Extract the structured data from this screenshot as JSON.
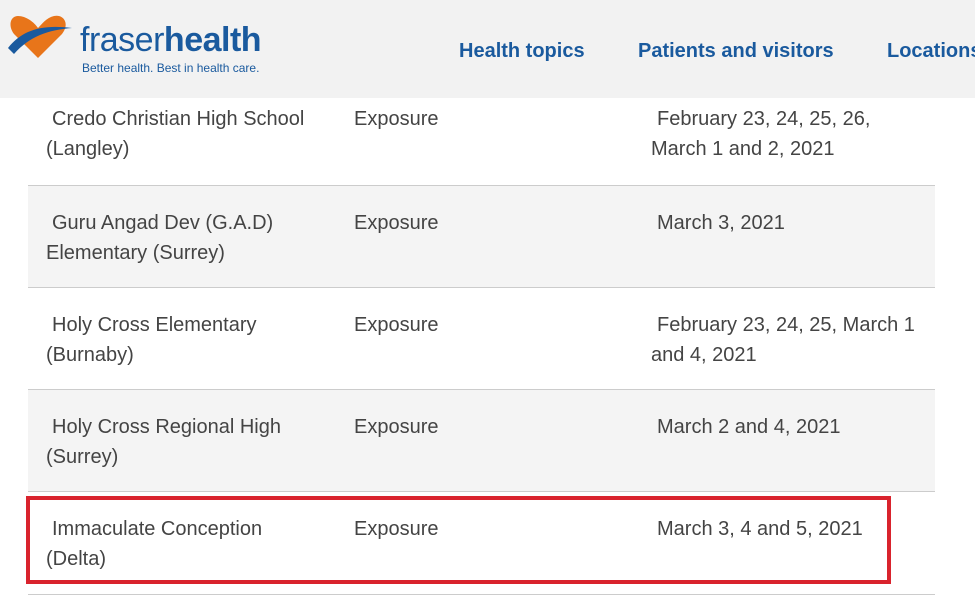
{
  "header": {
    "brand_prefix": "fraser",
    "brand_suffix": "health",
    "tagline": "Better health. Best in health care.",
    "nav": [
      {
        "label": "Health topics"
      },
      {
        "label": "Patients and visitors"
      },
      {
        "label": "Locations"
      }
    ]
  },
  "table": {
    "rows": [
      {
        "school": "Credo Christian High School (Langley)",
        "type": "Exposure",
        "dates": "February 23, 24, 25, 26, March 1 and 2, 2021"
      },
      {
        "school": "Guru Angad Dev (G.A.D) Elementary (Surrey)",
        "type": "Exposure",
        "dates": "March 3, 2021"
      },
      {
        "school": "Holy Cross Elementary (Burnaby)",
        "type": "Exposure",
        "dates": "February 23, 24, 25, March 1 and 4, 2021"
      },
      {
        "school": "Holy Cross Regional High (Surrey)",
        "type": "Exposure",
        "dates": "March 2 and 4, 2021"
      },
      {
        "school": "Immaculate Conception (Delta)",
        "type": "Exposure",
        "dates": "March 3, 4 and 5, 2021"
      }
    ]
  },
  "colors": {
    "brand": "#1a5a9e",
    "logo_orange": "#e8751a",
    "highlight": "#d9232d"
  }
}
